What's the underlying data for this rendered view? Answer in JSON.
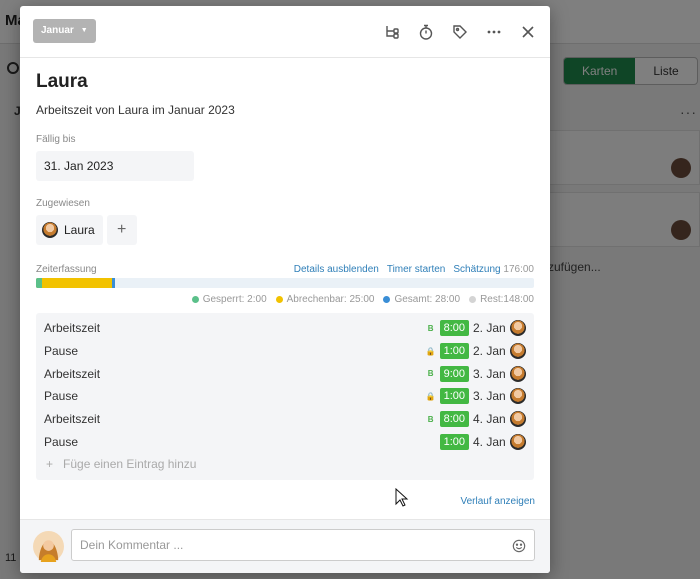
{
  "background": {
    "app_title": "Ma",
    "view_toggle": [
      "Karten",
      "Liste"
    ],
    "column_initial": "J",
    "add_card_partial": "zufügen...",
    "footer_number": "11"
  },
  "modal": {
    "month": "Januar",
    "title": "Laura",
    "description": "Arbeitszeit von Laura im Januar 2023",
    "due": {
      "label": "Fällig bis",
      "value": "31. Jan 2023"
    },
    "assigned": {
      "label": "Zugewiesen",
      "name": "Laura",
      "add": "+"
    },
    "time_tracking": {
      "label": "Zeiterfassung",
      "hide_details": "Details ausblenden",
      "start_timer": "Timer starten",
      "estimate_label": "Schätzung",
      "estimate_value": "176:00",
      "progress": {
        "total": 176,
        "locked": 2,
        "billable": 25,
        "overall": 28
      },
      "legend": [
        {
          "text": "Gesperrt: 2:00",
          "color": "#5bc08a"
        },
        {
          "text": "Abrechenbar: 25:00",
          "color": "#f2c200"
        },
        {
          "text": "Gesamt: 28:00",
          "color": "#3a8ed6"
        },
        {
          "text": "Rest:148:00",
          "color": "#d4d4d4"
        }
      ]
    },
    "entries": [
      {
        "type": "Arbeitszeit",
        "badge": "B",
        "badge_kind": "billable",
        "duration": "8:00",
        "date": "2. Jan"
      },
      {
        "type": "Pause",
        "badge": "🔒",
        "badge_kind": "locked",
        "duration": "1:00",
        "date": "2. Jan"
      },
      {
        "type": "Arbeitszeit",
        "badge": "B",
        "badge_kind": "billable",
        "duration": "9:00",
        "date": "3. Jan"
      },
      {
        "type": "Pause",
        "badge": "🔒",
        "badge_kind": "locked",
        "duration": "1:00",
        "date": "3. Jan"
      },
      {
        "type": "Arbeitszeit",
        "badge": "B",
        "badge_kind": "billable",
        "duration": "8:00",
        "date": "4. Jan"
      },
      {
        "type": "Pause",
        "badge": "",
        "badge_kind": "none",
        "duration": "1:00",
        "date": "4. Jan"
      }
    ],
    "add_entry": {
      "plus": "+",
      "text": "Füge einen Eintrag hinzu"
    },
    "history_link": "Verlauf anzeigen",
    "comment": {
      "placeholder": "Dein Kommentar ..."
    },
    "header_icons": [
      "checklist-tree-icon",
      "stopwatch-icon",
      "tag-icon",
      "more-icon",
      "close-icon"
    ]
  },
  "colors": {
    "accent_link": "#2f7fb8",
    "duration_green": "#43b843",
    "toggle_active": "#1f8a4c"
  }
}
